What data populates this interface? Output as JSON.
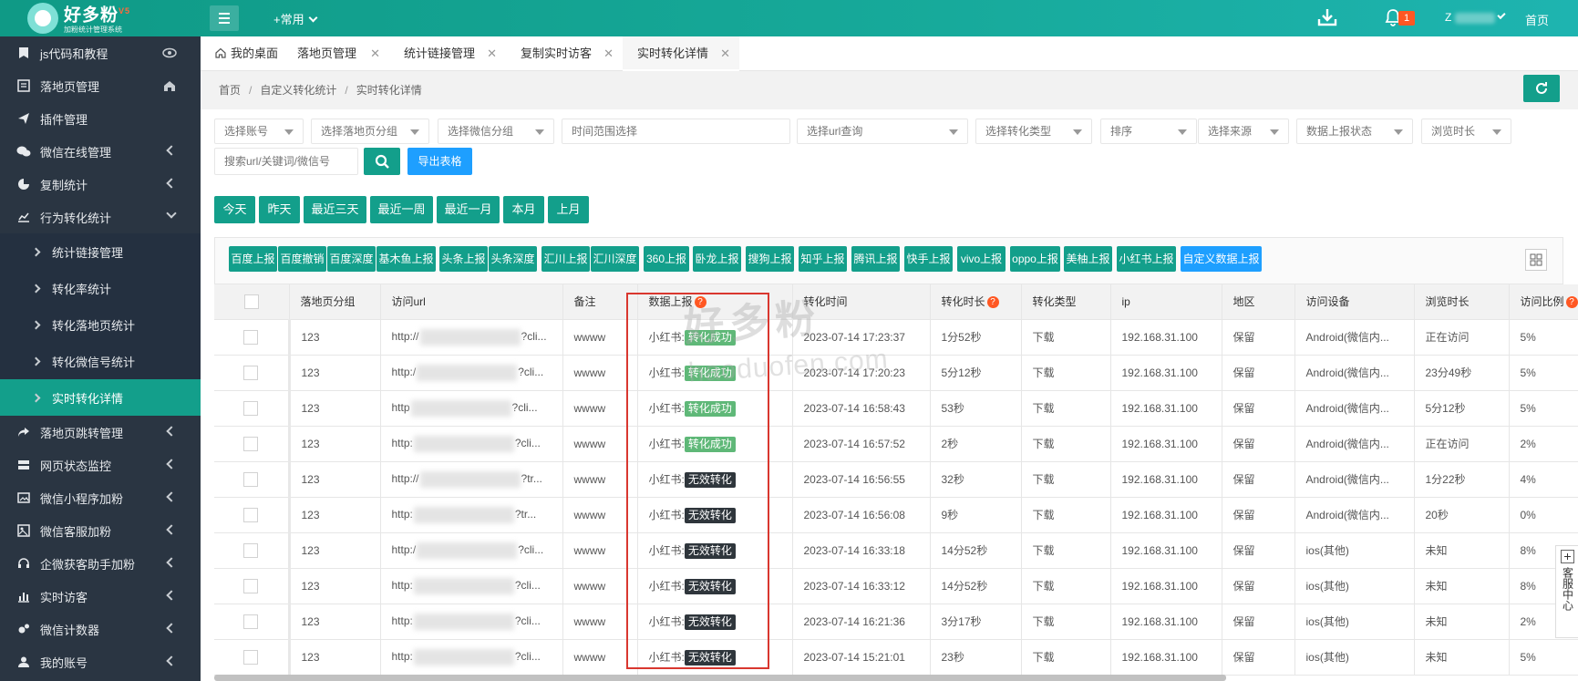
{
  "app": {
    "logo_title": "好多粉",
    "logo_sup": "V5",
    "logo_subtitle": "加粉统计管理系统",
    "common_menu": "+常用",
    "notification_count": "1",
    "user_initial": "Z",
    "home_link": "首页"
  },
  "sidebar": {
    "items": [
      {
        "label": "js代码和教程",
        "icon": "bookmark-icon"
      },
      {
        "label": "落地页管理",
        "icon": "page-icon"
      },
      {
        "label": "插件管理",
        "icon": "send-icon"
      },
      {
        "label": "微信在线管理",
        "icon": "wechat-icon"
      },
      {
        "label": "复制统计",
        "icon": "pie-icon"
      },
      {
        "label": "行为转化统计",
        "icon": "line-chart-icon"
      },
      {
        "label": "落地页跳转管理",
        "icon": "share-icon"
      },
      {
        "label": "网页状态监控",
        "icon": "server-icon"
      },
      {
        "label": "微信小程序加粉",
        "icon": "image-icon"
      },
      {
        "label": "微信客服加粉",
        "icon": "picture-icon"
      },
      {
        "label": "企微获客助手加粉",
        "icon": "headset-icon"
      },
      {
        "label": "实时访客",
        "icon": "bar-chart-icon"
      },
      {
        "label": "微信计数器",
        "icon": "gears-icon"
      },
      {
        "label": "我的账号",
        "icon": "user-icon"
      }
    ],
    "subitems": [
      {
        "label": "统计链接管理"
      },
      {
        "label": "转化率统计"
      },
      {
        "label": "转化落地页统计"
      },
      {
        "label": "转化微信号统计"
      },
      {
        "label": "实时转化详情"
      }
    ]
  },
  "tabs": [
    {
      "label": "我的桌面"
    },
    {
      "label": "落地页管理"
    },
    {
      "label": "统计链接管理"
    },
    {
      "label": "复制实时访客"
    },
    {
      "label": "实时转化详情"
    }
  ],
  "tab_close": "✕",
  "breadcrumb": {
    "home": "首页",
    "sep": "/",
    "parent": "自定义转化统计",
    "current": "实时转化详情"
  },
  "filters": {
    "account": "选择账号",
    "landing_group": "选择落地页分组",
    "wechat_group": "选择微信分组",
    "time_range": "时间范围选择",
    "url_query": "选择url查询",
    "conv_type": "选择转化类型",
    "sort": "排序",
    "source": "选择来源",
    "report_status": "数据上报状态",
    "duration": "浏览时长",
    "search_placeholder": "搜索url/关键词/微信号",
    "export": "导出表格"
  },
  "date_buttons": [
    "今天",
    "昨天",
    "最近三天",
    "最近一周",
    "最近一月",
    "本月",
    "上月"
  ],
  "report_buttons": [
    "百度上报",
    "百度撤销",
    "百度深度",
    "基木鱼上报",
    "头条上报",
    "头条深度",
    "汇川上报",
    "汇川深度",
    "360上报",
    "卧龙上报",
    "搜狗上报",
    "知乎上报",
    "腾讯上报",
    "快手上报",
    "vivo上报",
    "oppo上报",
    "美柚上报",
    "小红书上报",
    "自定义数据上报"
  ],
  "table": {
    "help_glyph": "?",
    "headers": {
      "group": "落地页分组",
      "url": "访问url",
      "note": "备注",
      "report": "数据上报",
      "conv_time": "转化时间",
      "conv_duration": "转化时长",
      "conv_type": "转化类型",
      "ip": "ip",
      "region": "地区",
      "device": "访问设备",
      "browse": "浏览时长",
      "ratio": "访问比例"
    },
    "rows": [
      {
        "group": "123",
        "url_pre": "http://",
        "url_post": "?cli...",
        "note": "wwww",
        "platform": "小红书:",
        "status": "转化成功",
        "ok": true,
        "time": "2023-07-14 17:23:37",
        "duration": "1分52秒",
        "type": "下载",
        "ip": "192.168.31.100",
        "region": "保留",
        "device": "Android(微信内...",
        "browse": "正在访问",
        "ratio": "5%"
      },
      {
        "group": "123",
        "url_pre": "http:/",
        "url_post": "?cli...",
        "note": "wwww",
        "platform": "小红书:",
        "status": "转化成功",
        "ok": true,
        "time": "2023-07-14 17:20:23",
        "duration": "5分12秒",
        "type": "下载",
        "ip": "192.168.31.100",
        "region": "保留",
        "device": "Android(微信内...",
        "browse": "23分49秒",
        "ratio": "5%"
      },
      {
        "group": "123",
        "url_pre": "http",
        "url_post": "?cli...",
        "note": "wwww",
        "platform": "小红书:",
        "status": "转化成功",
        "ok": true,
        "time": "2023-07-14 16:58:43",
        "duration": "53秒",
        "type": "下载",
        "ip": "192.168.31.100",
        "region": "保留",
        "device": "Android(微信内...",
        "browse": "5分12秒",
        "ratio": "5%"
      },
      {
        "group": "123",
        "url_pre": "http:",
        "url_post": "?cli...",
        "note": "wwww",
        "platform": "小红书:",
        "status": "转化成功",
        "ok": true,
        "time": "2023-07-14 16:57:52",
        "duration": "2秒",
        "type": "下载",
        "ip": "192.168.31.100",
        "region": "保留",
        "device": "Android(微信内...",
        "browse": "正在访问",
        "ratio": "2%"
      },
      {
        "group": "123",
        "url_pre": "http://",
        "url_post": "?tr...",
        "note": "wwww",
        "platform": "小红书:",
        "status": "无效转化",
        "ok": false,
        "time": "2023-07-14 16:56:55",
        "duration": "32秒",
        "type": "下载",
        "ip": "192.168.31.100",
        "region": "保留",
        "device": "Android(微信内...",
        "browse": "1分22秒",
        "ratio": "4%"
      },
      {
        "group": "123",
        "url_pre": "http:",
        "url_post": "?tr...",
        "note": "wwww",
        "platform": "小红书:",
        "status": "无效转化",
        "ok": false,
        "time": "2023-07-14 16:56:08",
        "duration": "9秒",
        "type": "下载",
        "ip": "192.168.31.100",
        "region": "保留",
        "device": "Android(微信内...",
        "browse": "20秒",
        "ratio": "0%"
      },
      {
        "group": "123",
        "url_pre": "http:/",
        "url_post": "?cli...",
        "note": "wwww",
        "platform": "小红书:",
        "status": "无效转化",
        "ok": false,
        "time": "2023-07-14 16:33:18",
        "duration": "14分52秒",
        "type": "下载",
        "ip": "192.168.31.100",
        "region": "保留",
        "device": "ios(其他)",
        "browse": "未知",
        "ratio": "8%"
      },
      {
        "group": "123",
        "url_pre": "http:",
        "url_post": "?cli...",
        "note": "wwww",
        "platform": "小红书:",
        "status": "无效转化",
        "ok": false,
        "time": "2023-07-14 16:33:12",
        "duration": "14分52秒",
        "type": "下载",
        "ip": "192.168.31.100",
        "region": "保留",
        "device": "ios(其他)",
        "browse": "未知",
        "ratio": "8%"
      },
      {
        "group": "123",
        "url_pre": "http:",
        "url_post": "?cli...",
        "note": "wwww",
        "platform": "小红书:",
        "status": "无效转化",
        "ok": false,
        "time": "2023-07-14 16:21:36",
        "duration": "3分17秒",
        "type": "下载",
        "ip": "192.168.31.100",
        "region": "保留",
        "device": "ios(其他)",
        "browse": "未知",
        "ratio": "2%"
      },
      {
        "group": "123",
        "url_pre": "http:",
        "url_post": "?cli...",
        "note": "wwww",
        "platform": "小红书:",
        "status": "无效转化",
        "ok": false,
        "time": "2023-07-14 15:21:01",
        "duration": "23秒",
        "type": "下载",
        "ip": "192.168.31.100",
        "region": "保留",
        "device": "ios(其他)",
        "browse": "未知",
        "ratio": "5%"
      }
    ]
  },
  "watermark": {
    "main": "好多粉",
    "sub": "haoduofen.com"
  },
  "service_panel": {
    "label": "客服中心"
  },
  "colors": {
    "primary": "#139f8b",
    "blue": "#1e9fff",
    "success_tag": "#5fb878",
    "invalid_tag": "#2f363c",
    "sidebar": "#2a3542",
    "highlight": "#d9372f",
    "badge": "#ff5722"
  }
}
